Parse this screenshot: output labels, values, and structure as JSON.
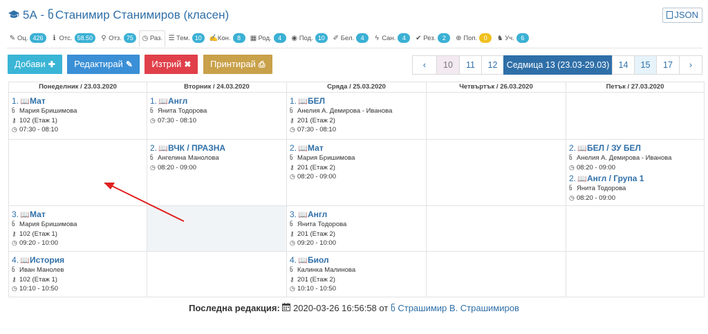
{
  "header": {
    "class": "5А",
    "separator": "-",
    "teacher": "Станимир Станимиров (класен)",
    "json_label": "JSON"
  },
  "tabs": [
    {
      "label": "Оц.",
      "icon": "pencil-icon",
      "count": "426",
      "color": "#3ab0d4"
    },
    {
      "label": "Отс.",
      "icon": "info-icon",
      "count": "58.50",
      "color": "#3ab0d4"
    },
    {
      "label": "Отз.",
      "icon": "user-search-icon",
      "count": "75",
      "color": "#3ab0d4"
    },
    {
      "label": "Раз.",
      "icon": "clock-icon",
      "count": "",
      "color": "",
      "active": true
    },
    {
      "label": "Тем.",
      "icon": "list-icon",
      "count": "10",
      "color": "#3ab0d4"
    },
    {
      "label": "Кон.",
      "icon": "edit-icon",
      "count": "8",
      "color": "#3ab0d4"
    },
    {
      "label": "Род.",
      "icon": "calendar-icon",
      "count": "4",
      "color": "#3ab0d4"
    },
    {
      "label": "Под.",
      "icon": "eye-icon",
      "count": "10",
      "color": "#3ab0d4"
    },
    {
      "label": "Бел.",
      "icon": "note-icon",
      "count": "4",
      "color": "#3ab0d4"
    },
    {
      "label": "Сан.",
      "icon": "bolt-icon",
      "count": "4",
      "color": "#3ab0d4"
    },
    {
      "label": "Рез.",
      "icon": "check-circle-icon",
      "count": "2",
      "color": "#3ab0d4"
    },
    {
      "label": "Поп.",
      "icon": "lifebuoy-icon",
      "count": "0",
      "color": "#f0c020"
    },
    {
      "label": "Уч.",
      "icon": "student-icon",
      "count": "6",
      "color": "#3ab0d4"
    }
  ],
  "toolbar": {
    "add": "Добави",
    "edit": "Редактирай",
    "delete": "Изтрий",
    "print": "Принтирай",
    "colors": {
      "add": "#3ab5d6",
      "edit": "#3a8fd6",
      "delete": "#e0404a",
      "print": "#c9a14a"
    }
  },
  "weeks": {
    "prev": "‹",
    "next": "›",
    "items": [
      {
        "label": "10",
        "state": "muted"
      },
      {
        "label": "11",
        "state": "normal"
      },
      {
        "label": "12",
        "state": "normal"
      },
      {
        "label": "Седмица 13 (23.03-29.03)",
        "state": "current"
      },
      {
        "label": "14",
        "state": "normal"
      },
      {
        "label": "15",
        "state": "light"
      },
      {
        "label": "17",
        "state": "normal"
      }
    ]
  },
  "days": [
    "Понеделник / 23.03.2020",
    "Вторник / 24.03.2020",
    "Сряда / 25.03.2020",
    "Четвъртък / 26.03.2020",
    "Петък / 27.03.2020"
  ],
  "rows": [
    [
      [
        {
          "n": "1.",
          "s": "Мат",
          "t": "Мария Бришимова",
          "r": "102 (Етаж 1)",
          "h": "07:30 - 08:10"
        }
      ],
      [
        {
          "n": "1.",
          "s": "Англ",
          "t": "Янита Тодорова",
          "h": "07:30 - 08:10"
        }
      ],
      [
        {
          "n": "1.",
          "s": "БЕЛ",
          "t": "Анелия А. Демирова - Иванова",
          "r": "201 (Етаж 2)",
          "h": "07:30 - 08:10"
        }
      ],
      [],
      []
    ],
    [
      [],
      [
        {
          "n": "2.",
          "s": "ВЧК / ПРАЗНА",
          "t": "Ангелина Манолова",
          "h": "08:20 - 09:00"
        }
      ],
      [
        {
          "n": "2.",
          "s": "Мат",
          "t": "Мария Бришимова",
          "r": "201 (Етаж 2)",
          "h": "08:20 - 09:00"
        }
      ],
      [],
      [
        {
          "n": "2.",
          "s": "БЕЛ / ЗУ БЕЛ",
          "t": "Анелия А. Демирова - Иванова",
          "h": "08:20 - 09:00"
        },
        {
          "n": "2.",
          "s": "Англ / Група 1",
          "t": "Янита Тодорова",
          "h": "08:20 - 09:00"
        }
      ]
    ],
    [
      [
        {
          "n": "3.",
          "s": "Мат",
          "t": "Мария Бришимова",
          "r": "102 (Етаж 1)",
          "h": "09:20 - 10:00"
        }
      ],
      "shaded",
      [
        {
          "n": "3.",
          "s": "Англ",
          "t": "Янита Тодорова",
          "r": "201 (Етаж 2)",
          "h": "09:20 - 10:00"
        }
      ],
      [],
      []
    ],
    [
      [
        {
          "n": "4.",
          "s": "История",
          "t": "Иван Манолев",
          "r": "102 (Етаж 1)",
          "h": "10:10 - 10:50"
        }
      ],
      [],
      [
        {
          "n": "4.",
          "s": "Биол",
          "t": "Калинка Малинова",
          "r": "201 (Етаж 2)",
          "h": "10:10 - 10:50"
        }
      ],
      [],
      []
    ]
  ],
  "footer": {
    "label": "Последна редакция:",
    "datetime": "2020-03-26 16:56:58",
    "by": "от",
    "user": "Страшимир В. Страшимиров"
  },
  "annotation_color": "#e02020"
}
